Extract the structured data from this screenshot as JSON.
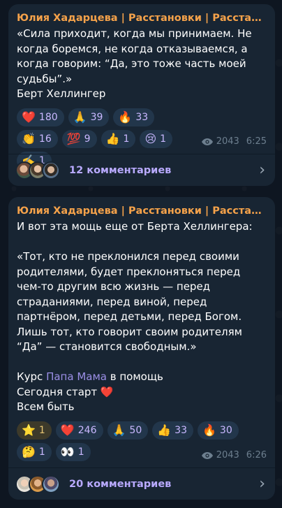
{
  "posts": [
    {
      "author": "Юлия Хадарцева | Расстановки | Расстановки",
      "text": "«Сила приходит, когда мы принимаем. Не когда боремся, не когда отказываемся, а когда говорим: “Да, это тоже часть моей судьбы”.»\nБерт Хеллингер",
      "reactions": [
        {
          "emoji": "❤️",
          "count": "180"
        },
        {
          "emoji": "🙏",
          "count": "39"
        },
        {
          "emoji": "🔥",
          "count": "33"
        },
        {
          "emoji": "👏",
          "count": "16"
        },
        {
          "emoji": "💯",
          "count": "9"
        },
        {
          "emoji": "👍",
          "count": "1"
        },
        {
          "emoji": "😢",
          "count": "1"
        },
        {
          "emoji": "✍️",
          "count": "1"
        }
      ],
      "views": "2043",
      "time": "6:25",
      "comments_label": "12 комментариев"
    },
    {
      "author": "Юлия Хадарцева | Расстановки | Расстановки",
      "text_intro": "И вот эта мощь еще от Берта Хеллингера:\n\n«Тот, кто не преклонился перед своими родителями, будет преклоняться перед чем-то другим всю жизнь — перед страданиями, перед виной, перед партнёром, перед детьми, перед Богом. Лишь тот, кто говорит своим родителям “Да” — становится свободным.»\n\nКурс ",
      "link_text": "Папа Мама",
      "text_after_link": " в помощь",
      "line_start": "Сегодня старт ❤️",
      "line_end": "Всем быть",
      "reactions": [
        {
          "emoji": "⭐",
          "count": "1",
          "own": true
        },
        {
          "emoji": "❤️",
          "count": "246"
        },
        {
          "emoji": "🙏",
          "count": "50"
        },
        {
          "emoji": "👍",
          "count": "33"
        },
        {
          "emoji": "🔥",
          "count": "30"
        },
        {
          "emoji": "🤔",
          "count": "1"
        },
        {
          "emoji": "👀",
          "count": "1"
        }
      ],
      "views": "2043",
      "time": "6:26",
      "comments_label": "20 комментариев"
    }
  ],
  "icons": {
    "views": "eye-icon",
    "comments_arrow": "chevron-right-icon"
  },
  "colors": {
    "author": "#f5a24a",
    "link": "#9b8fe6",
    "bubble": "#182533",
    "background": "#0e1621"
  }
}
